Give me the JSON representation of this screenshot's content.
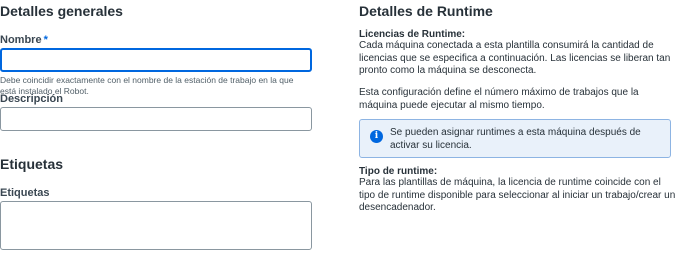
{
  "general": {
    "title": "Detalles generales",
    "name_label": "Nombre",
    "required_mark": "*",
    "name_value": "",
    "name_help": "Debe coincidir exactamente con el nombre de la estación de trabajo en la que está instalado el Robot.",
    "description_label": "Descripción",
    "description_value": ""
  },
  "tags": {
    "title": "Etiquetas",
    "label": "Etiquetas",
    "value": ""
  },
  "runtime": {
    "title": "Detalles de Runtime",
    "licenses_heading": "Licencias de Runtime:",
    "licenses_text": "Cada máquina conectada a esta plantilla consumirá la cantidad de licencias que se especifica a continuación. Las licencias se liberan tan pronto como la máquina se desconecta.",
    "config_text": "Esta configuración define el número máximo de trabajos que la máquina puede ejecutar al mismo tiempo.",
    "info_icon": "info-icon",
    "info_text": "Se pueden asignar runtimes a esta máquina después de activar su licencia.",
    "type_heading": "Tipo de runtime:",
    "type_text": "Para las plantillas de máquina, la licencia de runtime coincide con el tipo de runtime disponible para seleccionar al iniciar un trabajo/crear un desencadenador."
  },
  "colors": {
    "accent": "#0067df",
    "info_bg": "#e9f1fa",
    "text": "#273139"
  }
}
